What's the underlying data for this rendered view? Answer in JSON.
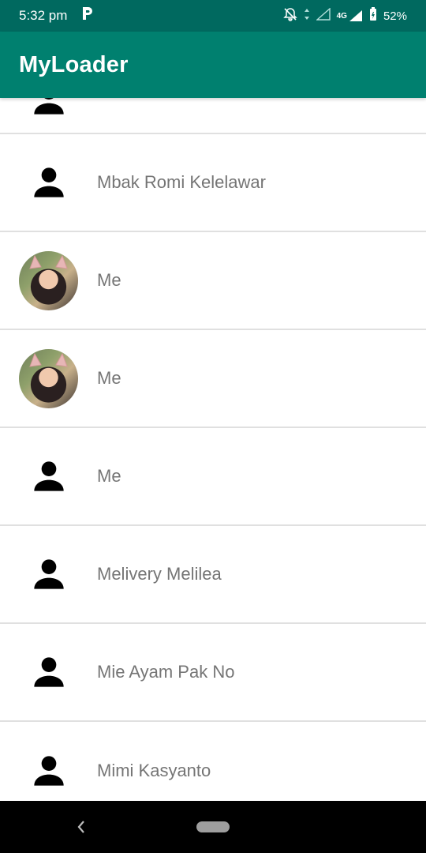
{
  "status_bar": {
    "time": "5:32 pm",
    "network": "4G",
    "battery": "52%"
  },
  "app_bar": {
    "title": "MyLoader"
  },
  "contacts": [
    {
      "name": "",
      "avatar": "person-icon"
    },
    {
      "name": "Mbak Romi Kelelawar",
      "avatar": "person-icon"
    },
    {
      "name": "Me",
      "avatar": "photo"
    },
    {
      "name": "Me",
      "avatar": "photo"
    },
    {
      "name": "Me",
      "avatar": "person-icon"
    },
    {
      "name": "Melivery Melilea",
      "avatar": "person-icon"
    },
    {
      "name": "Mie Ayam Pak No",
      "avatar": "person-icon"
    },
    {
      "name": "Mimi Kasyanto",
      "avatar": "person-icon"
    }
  ],
  "colors": {
    "status_bar": "#00695f",
    "app_bar": "#00806f",
    "divider": "#e0e0e0",
    "name_text": "#757575"
  }
}
